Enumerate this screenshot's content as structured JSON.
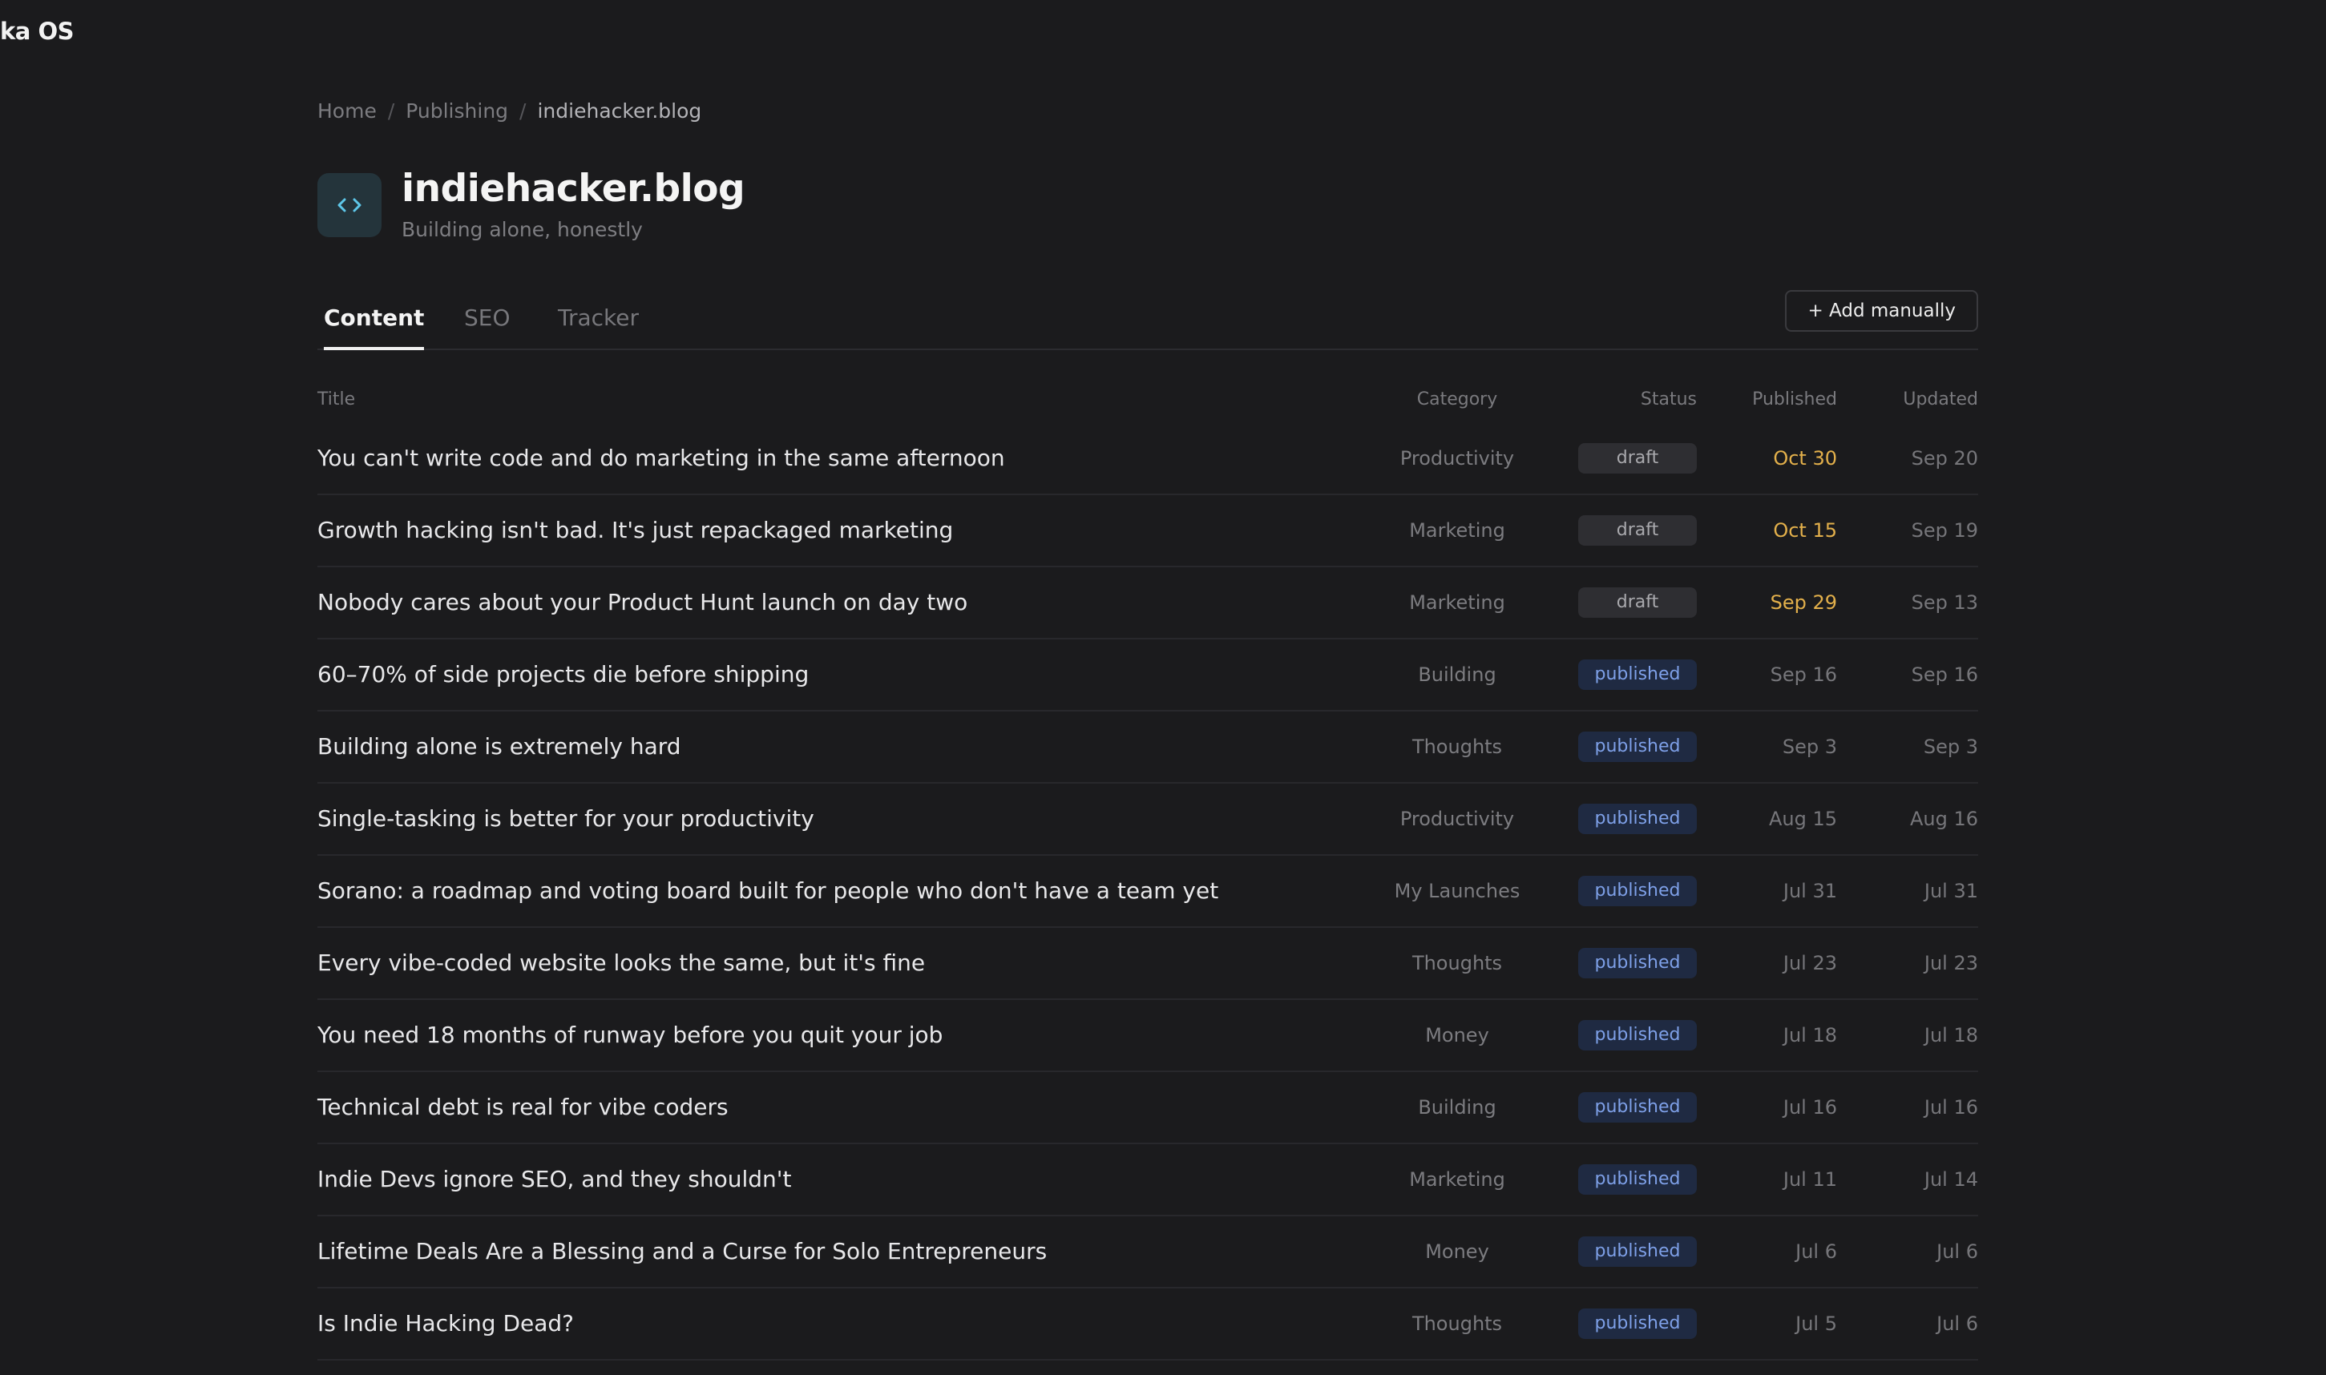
{
  "app": {
    "title": "ka OS"
  },
  "breadcrumb": {
    "items": [
      "Home",
      "Publishing"
    ],
    "current": "indiehacker.blog"
  },
  "header": {
    "icon": "code-icon",
    "title": "indiehacker.blog",
    "subtitle": "Building alone, honestly"
  },
  "tabs": [
    {
      "label": "Content",
      "active": true
    },
    {
      "label": "SEO",
      "active": false
    },
    {
      "label": "Tracker",
      "active": false
    }
  ],
  "actions": {
    "add_label": "+ Add manually"
  },
  "colors": {
    "background": "#1b1b1d",
    "accent_published_text": "#7ea0e8",
    "accent_published_bg": "#1f2a42",
    "upcoming_date": "#e3b04b",
    "icon_cyan": "#5ec6e8"
  },
  "table": {
    "columns": {
      "title": "Title",
      "category": "Category",
      "status": "Status",
      "published": "Published",
      "updated": "Updated"
    },
    "rows": [
      {
        "title": "You can't write code and do marketing in the same afternoon",
        "category": "Productivity",
        "status": "draft",
        "published": "Oct 30",
        "updated": "Sep 20",
        "upcoming": true
      },
      {
        "title": "Growth hacking isn't bad. It's just repackaged marketing",
        "category": "Marketing",
        "status": "draft",
        "published": "Oct 15",
        "updated": "Sep 19",
        "upcoming": true
      },
      {
        "title": "Nobody cares about your Product Hunt launch on day two",
        "category": "Marketing",
        "status": "draft",
        "published": "Sep 29",
        "updated": "Sep 13",
        "upcoming": true
      },
      {
        "title": "60–70% of side projects die before shipping",
        "category": "Building",
        "status": "published",
        "published": "Sep 16",
        "updated": "Sep 16",
        "upcoming": false
      },
      {
        "title": "Building alone is extremely hard",
        "category": "Thoughts",
        "status": "published",
        "published": "Sep 3",
        "updated": "Sep 3",
        "upcoming": false
      },
      {
        "title": "Single-tasking is better for your productivity",
        "category": "Productivity",
        "status": "published",
        "published": "Aug 15",
        "updated": "Aug 16",
        "upcoming": false
      },
      {
        "title": "Sorano: a roadmap and voting board built for people who don't have a team yet",
        "category": "My Launches",
        "status": "published",
        "published": "Jul 31",
        "updated": "Jul 31",
        "upcoming": false
      },
      {
        "title": "Every vibe-coded website looks the same, but it's fine",
        "category": "Thoughts",
        "status": "published",
        "published": "Jul 23",
        "updated": "Jul 23",
        "upcoming": false
      },
      {
        "title": "You need 18 months of runway before you quit your job",
        "category": "Money",
        "status": "published",
        "published": "Jul 18",
        "updated": "Jul 18",
        "upcoming": false
      },
      {
        "title": "Technical debt is real for vibe coders",
        "category": "Building",
        "status": "published",
        "published": "Jul 16",
        "updated": "Jul 16",
        "upcoming": false
      },
      {
        "title": "Indie Devs ignore SEO, and they shouldn't",
        "category": "Marketing",
        "status": "published",
        "published": "Jul 11",
        "updated": "Jul 14",
        "upcoming": false
      },
      {
        "title": "Lifetime Deals Are a Blessing and a Curse for Solo Entrepreneurs",
        "category": "Money",
        "status": "published",
        "published": "Jul 6",
        "updated": "Jul 6",
        "upcoming": false
      },
      {
        "title": "Is Indie Hacking Dead?",
        "category": "Thoughts",
        "status": "published",
        "published": "Jul 5",
        "updated": "Jul 6",
        "upcoming": false
      }
    ]
  }
}
